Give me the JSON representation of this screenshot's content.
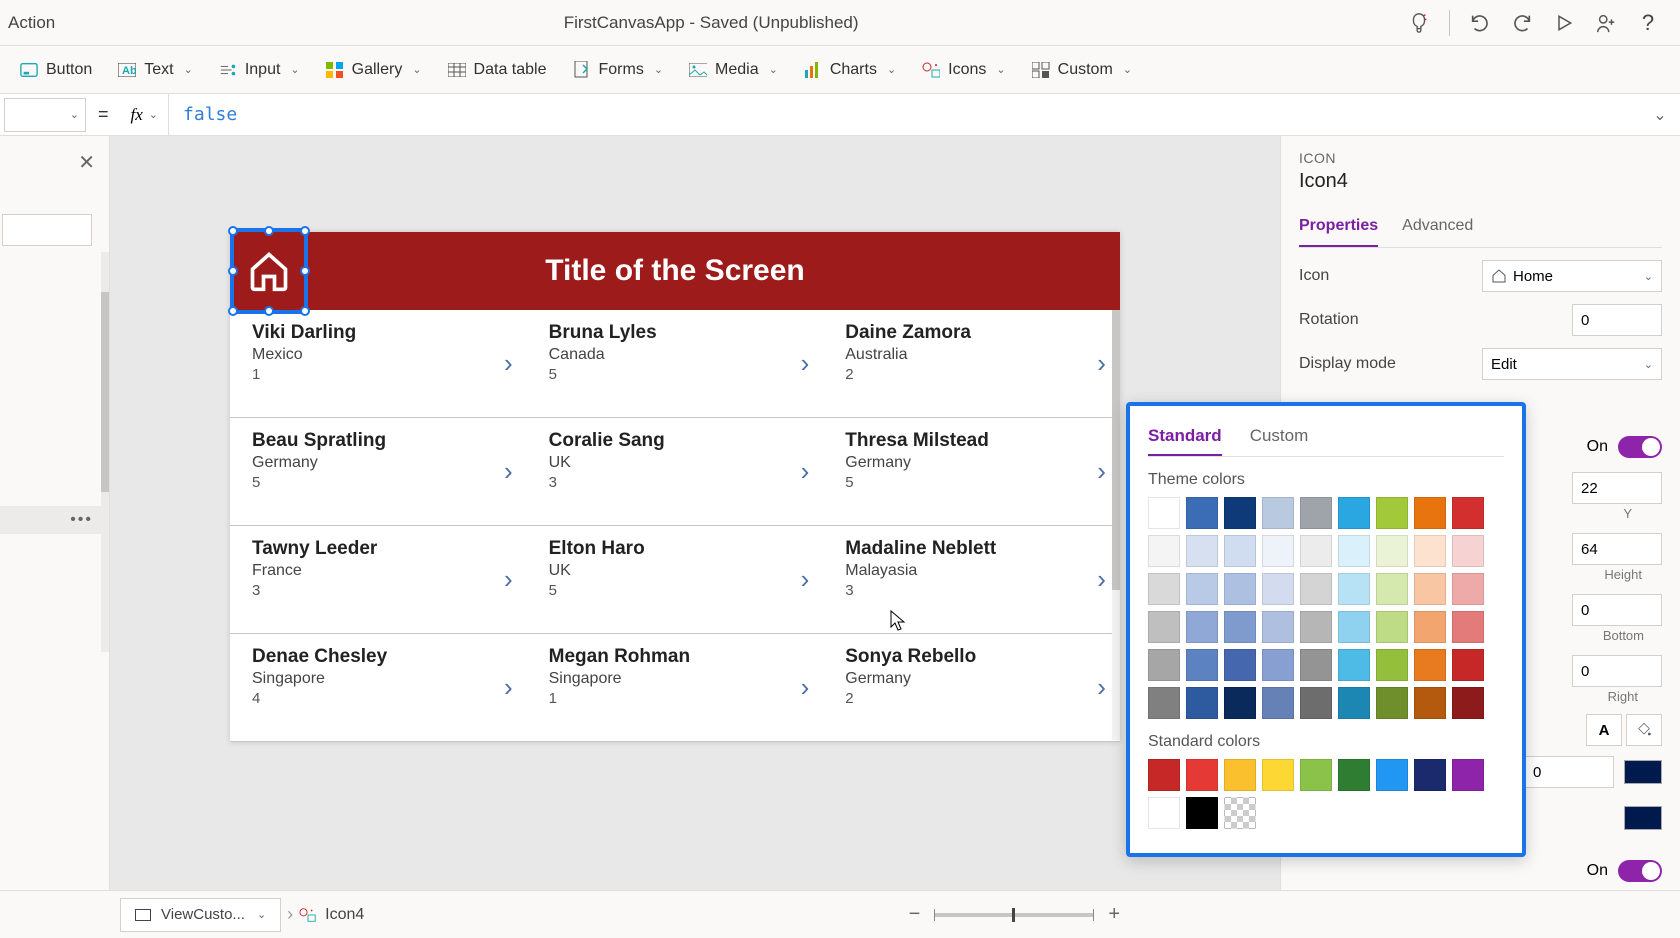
{
  "titlebar": {
    "menu_label": "Action",
    "app_title": "FirstCanvasApp - Saved (Unpublished)"
  },
  "ribbon": {
    "button": "Button",
    "text": "Text",
    "input": "Input",
    "gallery": "Gallery",
    "datatable": "Data table",
    "forms": "Forms",
    "media": "Media",
    "charts": "Charts",
    "icons": "Icons",
    "custom": "Custom"
  },
  "formula": {
    "value": "false"
  },
  "canvas": {
    "title": "Title of the Screen",
    "rows": [
      {
        "name": "Viki  Darling",
        "country": "Mexico",
        "num": "1"
      },
      {
        "name": "Bruna  Lyles",
        "country": "Canada",
        "num": "5"
      },
      {
        "name": "Daine  Zamora",
        "country": "Australia",
        "num": "2"
      },
      {
        "name": "Beau  Spratling",
        "country": "Germany",
        "num": "5"
      },
      {
        "name": "Coralie  Sang",
        "country": "UK",
        "num": "3"
      },
      {
        "name": "Thresa  Milstead",
        "country": "Germany",
        "num": "5"
      },
      {
        "name": "Tawny  Leeder",
        "country": "France",
        "num": "3"
      },
      {
        "name": "Elton  Haro",
        "country": "UK",
        "num": "5"
      },
      {
        "name": "Madaline  Neblett",
        "country": "Malayasia",
        "num": "3"
      },
      {
        "name": "Denae  Chesley",
        "country": "Singapore",
        "num": "4"
      },
      {
        "name": "Megan  Rohman",
        "country": "Singapore",
        "num": "1"
      },
      {
        "name": "Sonya  Rebello",
        "country": "Germany",
        "num": "2"
      }
    ]
  },
  "props": {
    "subtitle": "ICON",
    "title": "Icon4",
    "tab_properties": "Properties",
    "tab_advanced": "Advanced",
    "label_icon": "Icon",
    "value_icon": "Home",
    "label_rotation": "Rotation",
    "value_rotation": "0",
    "label_displaymode": "Display mode",
    "value_displaymode": "Edit",
    "toggle_on": "On",
    "value_x": "22",
    "label_y": "Y",
    "value_y": "64",
    "label_height": "Height",
    "value_pad_t": "0",
    "label_pad_b": "Bottom",
    "value_pad_l": "0",
    "label_pad_r": "Right",
    "font_A": "A",
    "value_num": "0",
    "toggle_on2": "On"
  },
  "colorpicker": {
    "tab_standard": "Standard",
    "tab_custom": "Custom",
    "label_theme": "Theme colors",
    "label_standard": "Standard colors",
    "theme_rows": [
      [
        "#ffffff",
        "#3a6db5",
        "#0e3a7a",
        "#b8c9e0",
        "#9fa3aa",
        "#2aa6e0",
        "#a2c93a",
        "#e87410",
        "#d32f2f"
      ],
      [
        "#f4f4f4",
        "#d7e0f0",
        "#d0ddf0",
        "#eef2f9",
        "#ececec",
        "#daf0fa",
        "#eaf3d5",
        "#fce2cf",
        "#f6d2d2"
      ],
      [
        "#d9d9d9",
        "#b8cae6",
        "#aec0e2",
        "#d2dcee",
        "#d4d4d4",
        "#b7e2f5",
        "#d5e8ad",
        "#f8c6a2",
        "#eea9a9"
      ],
      [
        "#bfbfbf",
        "#8fa8d6",
        "#7f9bce",
        "#aebfe0",
        "#b6b6b6",
        "#8fd2ef",
        "#bedb85",
        "#f3a56f",
        "#e47b7b"
      ],
      [
        "#a6a6a6",
        "#5d82c1",
        "#4567ad",
        "#88a0d1",
        "#949494",
        "#4ebae6",
        "#93bf3d",
        "#e87a1f",
        "#c62828"
      ],
      [
        "#808080",
        "#2e5aa0",
        "#0a2a5c",
        "#6681b6",
        "#6d6d6d",
        "#1c87b3",
        "#6e8f2c",
        "#b35a0f",
        "#8e1b1b"
      ]
    ],
    "standard_rows": [
      [
        "#c62828",
        "#e53935",
        "#fbc02d",
        "#fdd835",
        "#8bc34a",
        "#2e7d32",
        "#2196f3",
        "#1a2a6c",
        "#8e24aa"
      ],
      [
        "#ffffff",
        "#000000",
        "trans"
      ]
    ]
  },
  "bottombar": {
    "bc1": "ViewCusto...",
    "bc2": "Icon4",
    "minus": "−",
    "plus": "+"
  }
}
